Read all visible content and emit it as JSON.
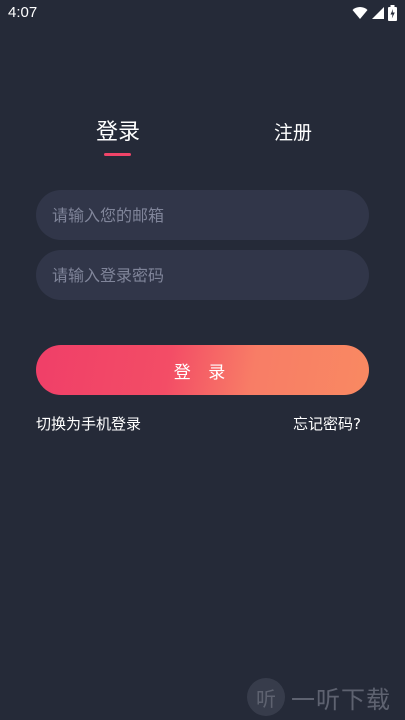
{
  "status_bar": {
    "time": "4:07",
    "icons": [
      "wifi-icon",
      "signal-icon",
      "battery-icon"
    ]
  },
  "tabs": {
    "login_label": "登录",
    "register_label": "注册",
    "active": "login",
    "indicator_color": "#f04468"
  },
  "form": {
    "email_placeholder": "请输入您的邮箱",
    "email_value": "",
    "password_placeholder": "请输入登录密码",
    "password_value": ""
  },
  "login_button": {
    "label": "登 录",
    "gradient_start": "#f03f68",
    "gradient_end": "#f98962"
  },
  "links": {
    "switch_phone": "切换为手机登录",
    "forgot_password": "忘记密码?"
  },
  "watermark": {
    "logo_glyph": "听",
    "text": "一听下载"
  },
  "colors": {
    "background": "#252a38",
    "input_background": "#313649",
    "placeholder": "#80859a"
  }
}
